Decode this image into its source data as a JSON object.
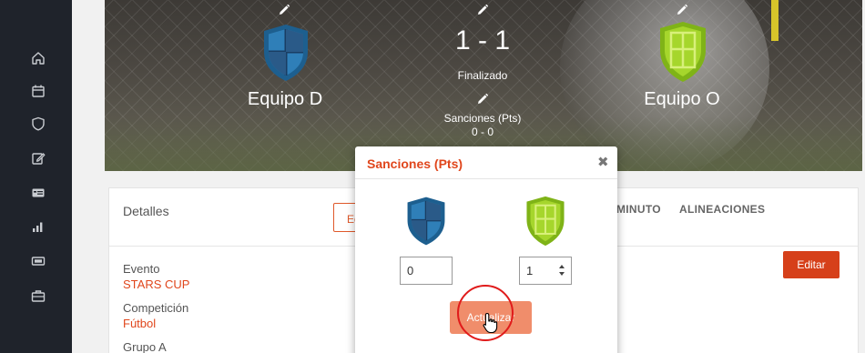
{
  "sidebar": {
    "icons": [
      "home-icon",
      "calendar-icon",
      "shield-icon",
      "edit-icon",
      "id-card-icon",
      "bar-chart-icon",
      "ticket-icon",
      "briefcase-icon"
    ]
  },
  "match": {
    "home_team": "Equipo D",
    "away_team": "Equipo O",
    "score": "1 - 1",
    "status": "Finalizado",
    "sanctions_label": "Sanciones (Pts)",
    "sanctions_value": "0 - 0",
    "home_color": "#1d5f8f",
    "away_color": "#8dc21f"
  },
  "details": {
    "title": "Detalles",
    "edit_partial": "Ed",
    "tabs": [
      "MINUTO",
      "ALINEACIONES"
    ],
    "edit_button": "Editar",
    "fields": [
      {
        "label": "Evento",
        "value": "STARS CUP"
      },
      {
        "label": "Competición",
        "value": "Fútbol"
      },
      {
        "label": "Grupo A",
        "value": ""
      }
    ]
  },
  "modal": {
    "title": "Sanciones (Pts)",
    "close": "✖",
    "home_value": "0",
    "away_value": "1",
    "update_button": "Actualizar"
  },
  "colors": {
    "accent": "#e0461c",
    "button": "#d6401a",
    "button_hover": "#f08d6b",
    "sidebar": "#1f232b"
  }
}
